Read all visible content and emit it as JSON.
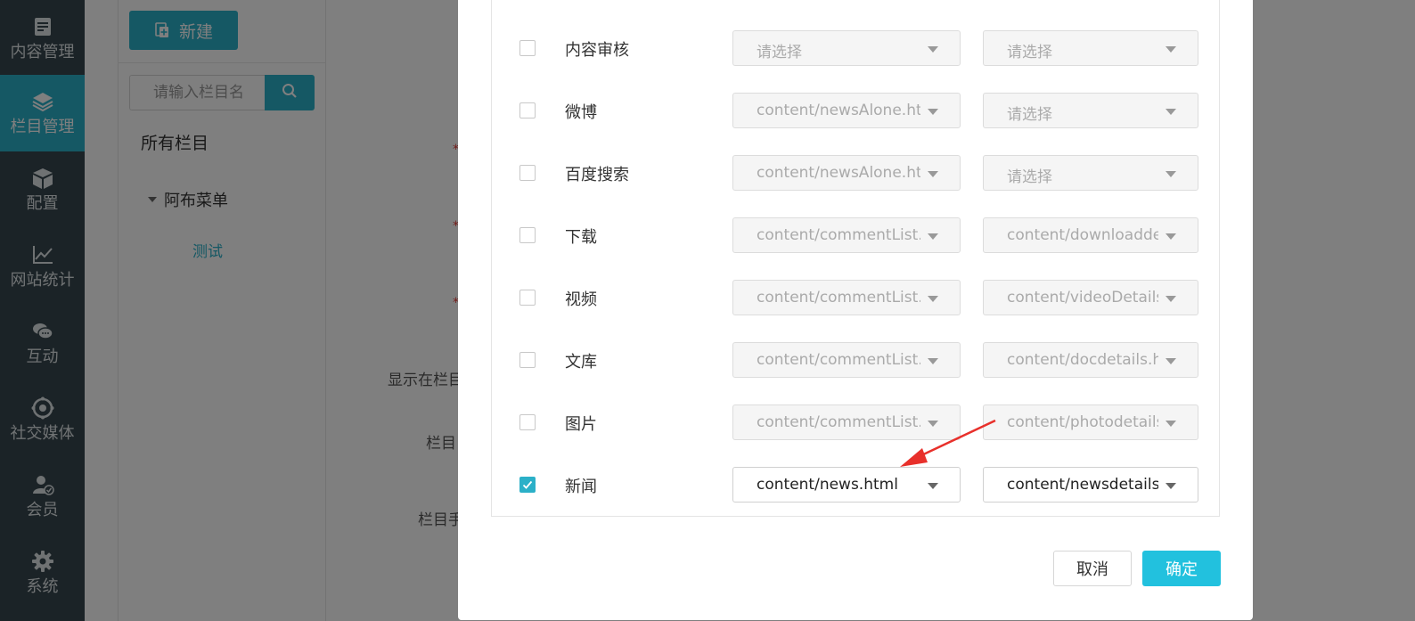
{
  "sidebar": {
    "items": [
      {
        "label": "内容管理",
        "icon": "document-edit-icon",
        "active": false
      },
      {
        "label": "栏目管理",
        "icon": "layers-icon",
        "active": true
      },
      {
        "label": "配置",
        "icon": "cube-icon",
        "active": false
      },
      {
        "label": "网站统计",
        "icon": "line-chart-icon",
        "active": false
      },
      {
        "label": "互动",
        "icon": "chat-bubbles-icon",
        "active": false
      },
      {
        "label": "社交媒体",
        "icon": "social-target-icon",
        "active": false
      },
      {
        "label": "会员",
        "icon": "member-verified-icon",
        "active": false
      },
      {
        "label": "系统",
        "icon": "gear-icon",
        "active": false
      }
    ]
  },
  "tree_panel": {
    "new_label": "新建",
    "search_placeholder": "请输入栏目名",
    "root_label": "所有栏目",
    "node_label": "阿布菜单",
    "leaf_label": "测试"
  },
  "form_labels": {
    "show_in_column": "显示在栏目",
    "column_name": "栏目",
    "column_manual": "栏目手"
  },
  "dialog": {
    "rows": [
      {
        "label": "内容审核",
        "checked": false,
        "list_template": "请选择",
        "detail_template": "请选择",
        "enabled": false
      },
      {
        "label": "微博",
        "checked": false,
        "list_template": "content/newsAlone.html",
        "detail_template": "请选择",
        "enabled": false
      },
      {
        "label": "百度搜索",
        "checked": false,
        "list_template": "content/newsAlone.html",
        "detail_template": "请选择",
        "enabled": false
      },
      {
        "label": "下载",
        "checked": false,
        "list_template": "content/commentList.html",
        "detail_template": "content/downloaddetails.html",
        "enabled": false
      },
      {
        "label": "视频",
        "checked": false,
        "list_template": "content/commentList.html",
        "detail_template": "content/videoDetails.html",
        "enabled": false
      },
      {
        "label": "文库",
        "checked": false,
        "list_template": "content/commentList.html",
        "detail_template": "content/docdetails.html",
        "enabled": false
      },
      {
        "label": "图片",
        "checked": false,
        "list_template": "content/commentList.html",
        "detail_template": "content/photodetails.html",
        "enabled": false
      },
      {
        "label": "新闻",
        "checked": true,
        "list_template": "content/news.html",
        "detail_template": "content/newsdetails.html",
        "enabled": true
      }
    ],
    "cancel_label": "取消",
    "ok_label": "确定"
  },
  "colors": {
    "accent": "#2bb0c8",
    "sidebar_bg": "#37474f",
    "ok_button": "#22c1de",
    "annotation_arrow": "#e8302b"
  }
}
